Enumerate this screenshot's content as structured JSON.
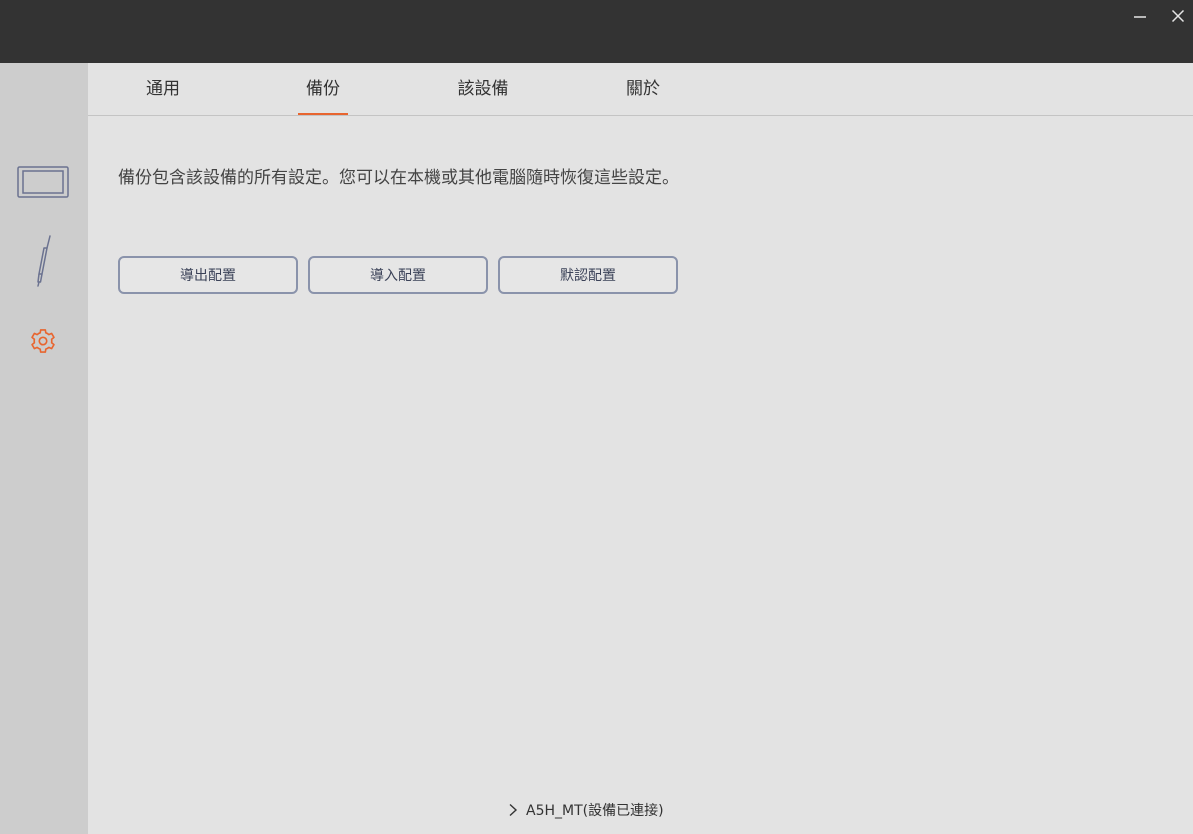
{
  "tabs": [
    {
      "label": "通用",
      "active": false
    },
    {
      "label": "備份",
      "active": true
    },
    {
      "label": "該設備",
      "active": false
    },
    {
      "label": "關於",
      "active": false
    }
  ],
  "backup": {
    "description": "備份包含該設備的所有設定。您可以在本機或其他電腦隨時恢復這些設定。",
    "export_label": "導出配置",
    "import_label": "導入配置",
    "default_label": "默認配置"
  },
  "footer": {
    "device_status": "A5H_MT(設備已連接)"
  },
  "sidebar": {
    "items": [
      {
        "icon": "tablet-icon",
        "active": false
      },
      {
        "icon": "pen-icon",
        "active": false
      },
      {
        "icon": "gear-icon",
        "active": true
      }
    ]
  },
  "colors": {
    "accent": "#e8652f",
    "titlebar": "#333333",
    "sidebar": "#cdcdcd",
    "background": "#e3e3e3",
    "button_border": "#8a93ab",
    "icon_stroke": "#6b7290"
  }
}
